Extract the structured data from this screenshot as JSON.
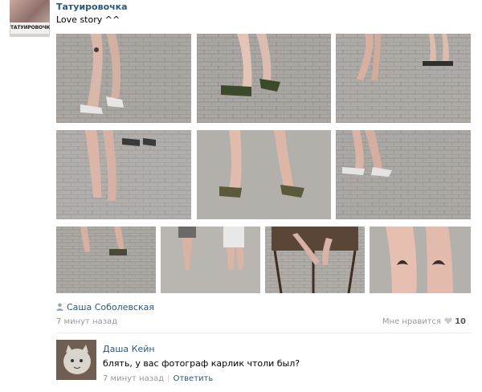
{
  "post": {
    "group_name": "Татуировочка",
    "avatar_text": "ТАТУИРОВОЧКА",
    "text": "Love story ^^",
    "photos": [
      {
        "name": "photo-1",
        "desc": "heels"
      },
      {
        "name": "photo-2",
        "desc": "sneakers"
      },
      {
        "name": "photo-3",
        "desc": "couple"
      },
      {
        "name": "photo-4",
        "desc": "legs"
      },
      {
        "name": "photo-5",
        "desc": "walking"
      },
      {
        "name": "photo-6",
        "desc": "couple2"
      },
      {
        "name": "photo-7",
        "desc": "couple3"
      },
      {
        "name": "photo-8",
        "desc": "couple4"
      },
      {
        "name": "photo-9",
        "desc": "cafe"
      },
      {
        "name": "photo-10",
        "desc": "tattoo"
      }
    ],
    "author": "Саша Соболевская",
    "time": "7 минут назад",
    "like_label": "Мне нравится",
    "like_count": "10"
  },
  "comment": {
    "name": "Даша Кейн",
    "text": "блять, у вас фотограф карлик чтоли был?",
    "time": "7 минут назад",
    "reply_label": "Ответить"
  },
  "colors": {
    "link": "#2b587a",
    "muted": "#999999"
  }
}
